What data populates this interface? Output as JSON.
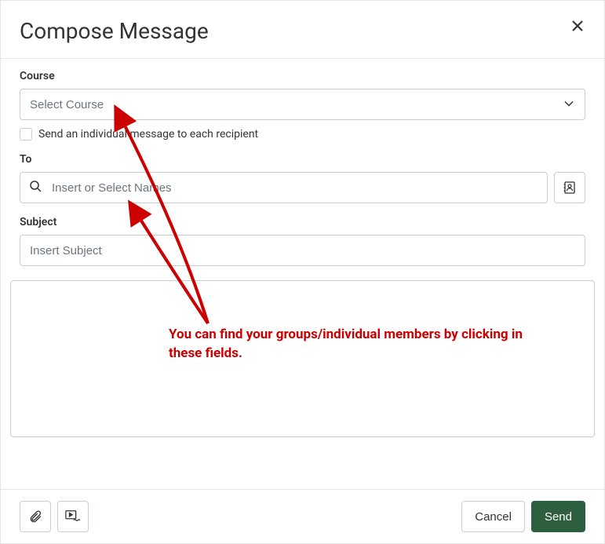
{
  "header": {
    "title": "Compose Message"
  },
  "course": {
    "label": "Course",
    "placeholder": "Select Course"
  },
  "individual": {
    "label": "Send an individual message to each recipient"
  },
  "to": {
    "label": "To",
    "placeholder": "Insert or Select Names"
  },
  "subject": {
    "label": "Subject",
    "placeholder": "Insert Subject"
  },
  "footer": {
    "cancel": "Cancel",
    "send": "Send"
  },
  "annotation": {
    "text": "You can find your groups/individual members by clicking in these fields."
  }
}
